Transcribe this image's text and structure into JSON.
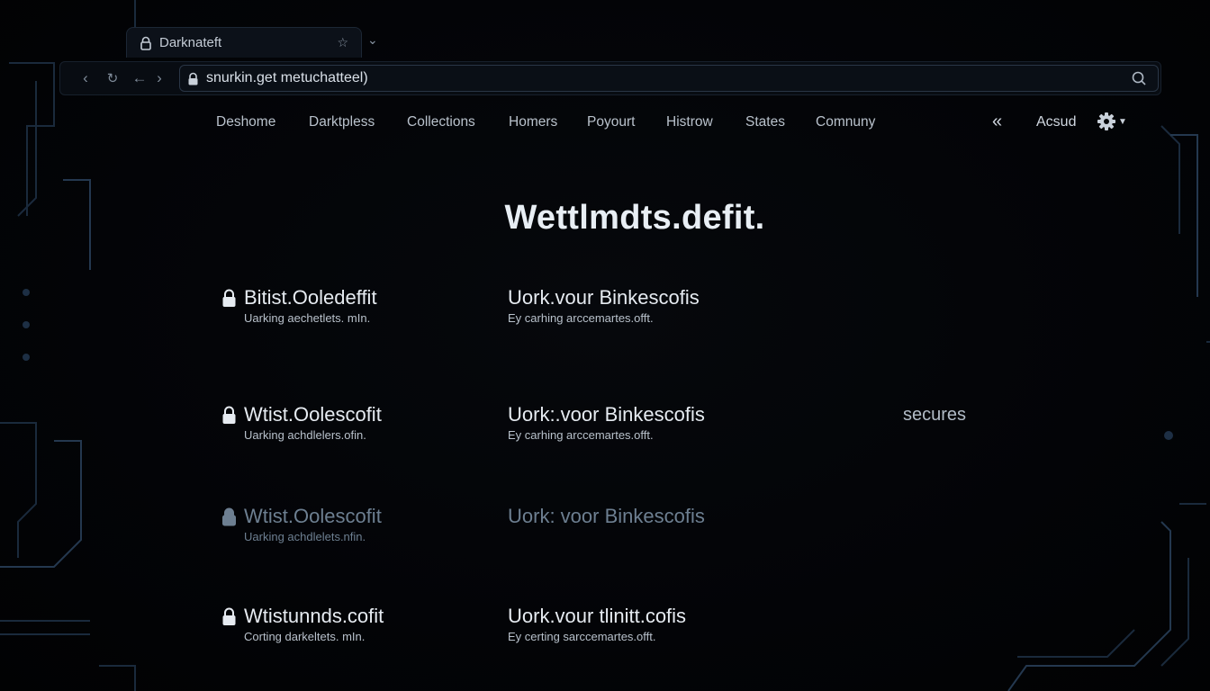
{
  "browser": {
    "tab_title": "Darknateft",
    "tab_icon": "lock-icon",
    "url": "snurkin.get metuchatteel)"
  },
  "site_nav": {
    "items": [
      "Deshome",
      "Darktpless",
      "Collections",
      "Homers",
      "Poyourt",
      "Histrow",
      "States",
      "Comnuny"
    ],
    "account_label": "Acsud"
  },
  "headline": "Wettlmdts.defit.",
  "rows": [
    {
      "a_title": "Bitist.Ooledeffit",
      "a_sub": "Uarking aechetlets. mIn.",
      "b_title": "Uork.vour Binkescofis",
      "b_sub": "Ey carhing arccemartes.offt."
    },
    {
      "a_title": "Wtist.Oolescofit",
      "a_sub": "Uarking achdlelers.ofin.",
      "b_title": "Uork:.voor Binkescofis",
      "b_sub": "Ey carhing arccemartes.offt."
    },
    {
      "a_title": "Wtist.Oolescofit",
      "a_sub": "Uarking achdlelets.nfin.",
      "b_title": "Uork: voor Binkescofis",
      "b_sub": ""
    },
    {
      "a_title": "Wtistunnds.cofit",
      "a_sub": "Corting darkeltets. mIn.",
      "b_title": "Uork.vour tlinitt.cofis",
      "b_sub": "Ey certing sarccemartes.offt."
    }
  ],
  "side_label": "secures",
  "colors": {
    "background": "#020305",
    "circuit": "#1a2a3c",
    "text": "#e6ebf1",
    "dim_text": "#6d7f91"
  }
}
